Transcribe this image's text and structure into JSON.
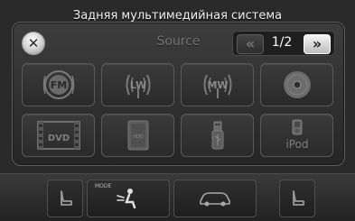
{
  "window": {
    "title": "Задняя мультимедийная система"
  },
  "header": {
    "source_label": "Source",
    "pager": {
      "prev_label": "«",
      "page_text": "1/2",
      "next_label": "»"
    }
  },
  "sources": [
    {
      "label": "FM",
      "icon": "fm-radio-icon"
    },
    {
      "label": "LW",
      "icon": "lw-radio-icon"
    },
    {
      "label": "MW",
      "icon": "mw-radio-icon"
    },
    {
      "label": "",
      "icon": "disc-icon"
    },
    {
      "label": "DVD",
      "icon": "dvd-icon"
    },
    {
      "label": "HDD",
      "icon": "hdd-icon"
    },
    {
      "label": "",
      "icon": "usb-icon"
    },
    {
      "label": "iPod",
      "icon": "ipod-icon"
    }
  ],
  "bottom_bar": {
    "buttons": [
      {
        "icon": "seat-heater-left-icon"
      },
      {
        "label": "MODE",
        "icon": "airflow-mode-icon"
      },
      {
        "icon": "car-icon"
      },
      {
        "icon": "seat-heater-right-icon"
      }
    ]
  },
  "colors": {
    "background": "#2a2a2a",
    "tile_border": "#595959",
    "icon_gray": "#7a7a7a",
    "accent_white": "#ffffff"
  }
}
